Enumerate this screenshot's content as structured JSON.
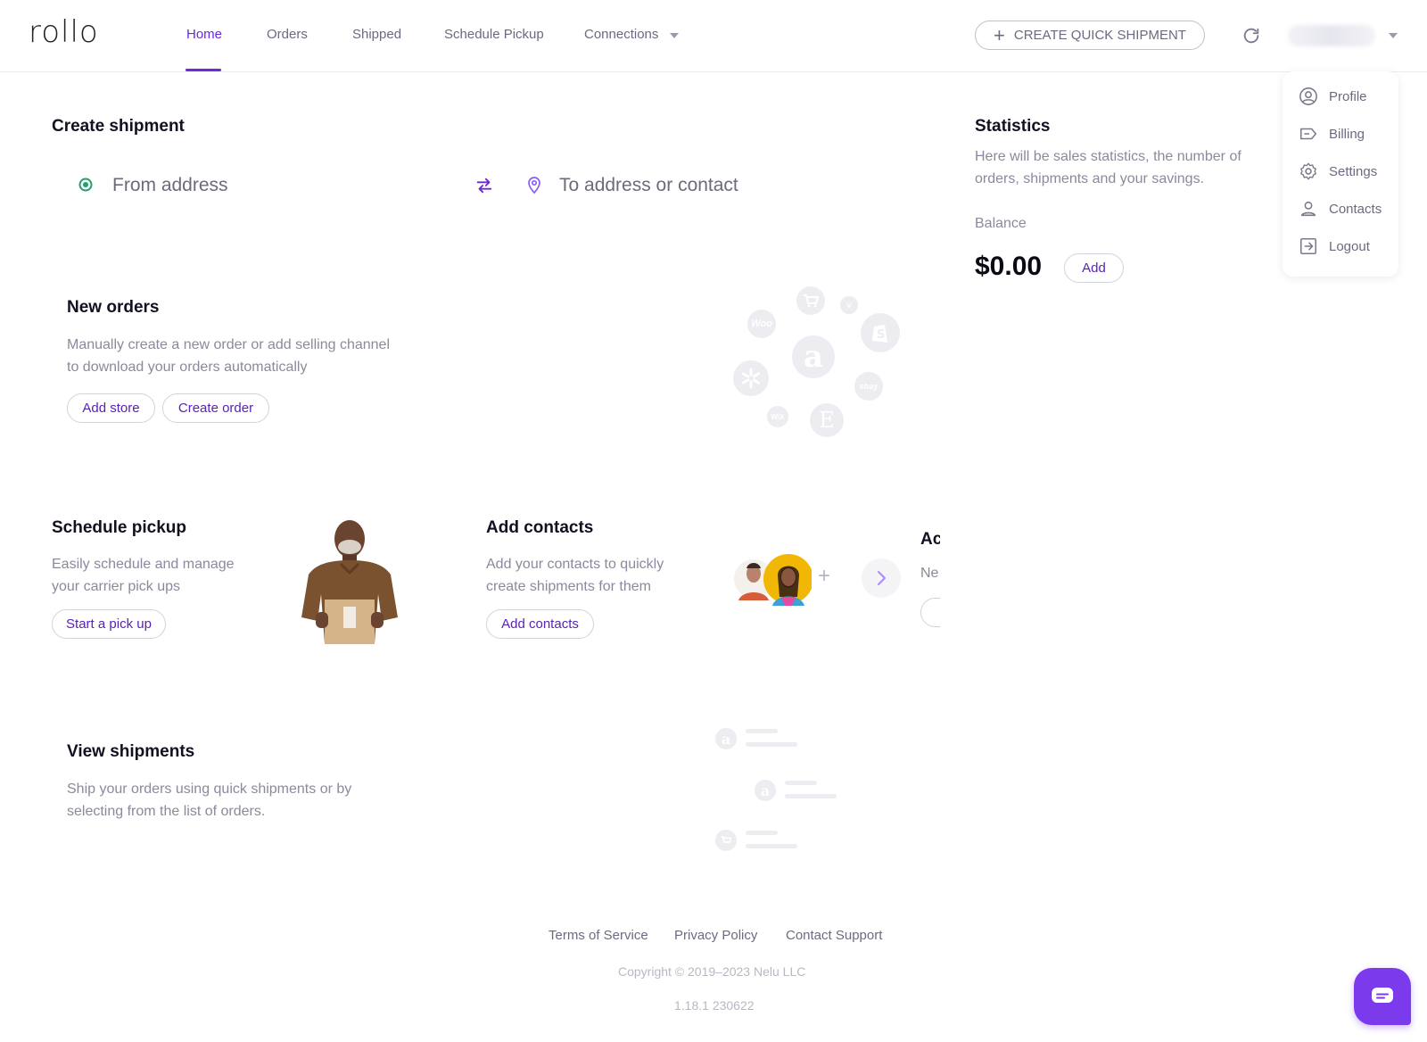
{
  "app": {
    "logo": "rollo"
  },
  "nav": {
    "items": [
      {
        "label": "Home"
      },
      {
        "label": "Orders"
      },
      {
        "label": "Shipped"
      },
      {
        "label": "Schedule Pickup"
      },
      {
        "label": "Connections"
      }
    ],
    "active": "Home"
  },
  "header": {
    "quick_shipment_label": "CREATE QUICK SHIPMENT",
    "refresh_icon": "refresh-icon"
  },
  "user_menu": {
    "items": [
      {
        "label": "Profile",
        "icon": "user-circle-icon"
      },
      {
        "label": "Billing",
        "icon": "tag-icon"
      },
      {
        "label": "Settings",
        "icon": "gear-icon"
      },
      {
        "label": "Contacts",
        "icon": "person-icon"
      },
      {
        "label": "Logout",
        "icon": "logout-icon"
      }
    ]
  },
  "create_shipment": {
    "title": "Create shipment",
    "from_placeholder": "From address",
    "to_placeholder": "To address or contact"
  },
  "statistics": {
    "title": "Statistics",
    "description_line1": "Here will be sales statistics, the number of",
    "description_line2": "orders, shipments and your savings.",
    "balance_label": "Balance",
    "balance_value": "$0.00",
    "add_label": "Add"
  },
  "new_orders": {
    "title": "New orders",
    "description_line1": "Manually create a new order or add selling channel",
    "description_line2": "to download your orders automatically",
    "add_store_label": "Add store",
    "create_order_label": "Create order"
  },
  "schedule_pickup": {
    "title": "Schedule pickup",
    "description_line1": "Easily schedule and manage",
    "description_line2": "your carrier pick ups",
    "button_label": "Start a pick up"
  },
  "add_contacts": {
    "title": "Add contacts",
    "description_line1": "Add your contacts to quickly",
    "description_line2": "create shipments for them",
    "button_label": "Add contacts"
  },
  "next_card": {
    "title_partial": "Ac",
    "desc_partial": "Ne"
  },
  "view_shipments": {
    "title": "View shipments",
    "description_line1": "Ship your orders using quick shipments or by",
    "description_line2": "selecting from the list of orders."
  },
  "footer": {
    "links": [
      {
        "label": "Terms of Service"
      },
      {
        "label": "Privacy Policy"
      },
      {
        "label": "Contact Support"
      }
    ],
    "copyright": "Copyright © 2019–2023 Nelu LLC",
    "version": "1.18.1 230622"
  },
  "channels": {
    "woo": "Woo",
    "ebay": "ebay",
    "wix": "WiX",
    "etsy": "E",
    "amazon": "a"
  },
  "colors": {
    "accent": "#6d28d9",
    "text_muted": "#8a8a9c",
    "chat_button": "#7c3aed",
    "from_dot": "#22a06b"
  }
}
